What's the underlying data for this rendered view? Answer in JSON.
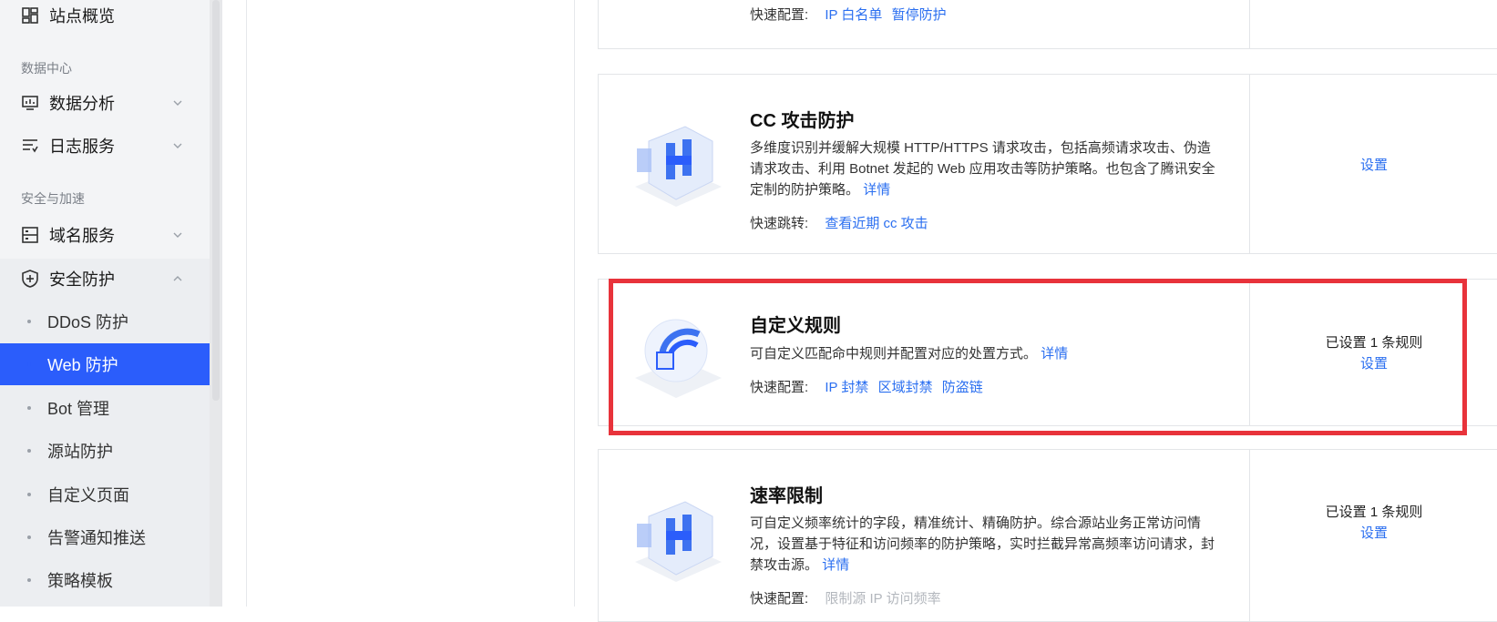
{
  "sidebar": {
    "site_overview": "站点概览",
    "group_data": "数据中心",
    "data_analysis": "数据分析",
    "log_service": "日志服务",
    "group_security": "安全与加速",
    "domain_service": "域名服务",
    "security_protection": "安全防护",
    "sub_items": [
      "DDoS 防护",
      "Web 防护",
      "Bot 管理",
      "源站防护",
      "自定义页面",
      "告警通知推送",
      "策略模板"
    ]
  },
  "cards": {
    "top": {
      "quick_label": "快速配置:",
      "links": [
        "IP 白名单",
        "暂停防护"
      ]
    },
    "cc": {
      "title": "CC 攻击防护",
      "desc": "多维度识别并缓解大规模 HTTP/HTTPS 请求攻击，包括高频请求攻击、伪造请求攻击、利用 Botnet 发起的 Web 应用攻击等防护策略。也包含了腾讯安全定制的防护策略。",
      "detail": "详情",
      "quick_label": "快速跳转:",
      "links": [
        "查看近期 cc 攻击"
      ],
      "setting": "设置"
    },
    "custom": {
      "title": "自定义规则",
      "desc": "可自定义匹配命中规则并配置对应的处置方式。",
      "detail": "详情",
      "quick_label": "快速配置:",
      "links": [
        "IP 封禁",
        "区域封禁",
        "防盗链"
      ],
      "status": "已设置 1 条规则",
      "setting": "设置"
    },
    "rate": {
      "title": "速率限制",
      "desc": "可自定义频率统计的字段，精准统计、精确防护。综合源站业务正常访问情况，设置基于特征和访问频率的防护策略，实时拦截异常高频率访问请求，封禁攻击源。",
      "detail": "详情",
      "quick_label": "快速配置:",
      "links": [
        "限制源 IP 访问频率"
      ],
      "status": "已设置 1 条规则",
      "setting": "设置"
    }
  },
  "colors": {
    "accent": "#2b5dfb",
    "link": "#2b6ff0",
    "highlight": "#e8333b"
  }
}
